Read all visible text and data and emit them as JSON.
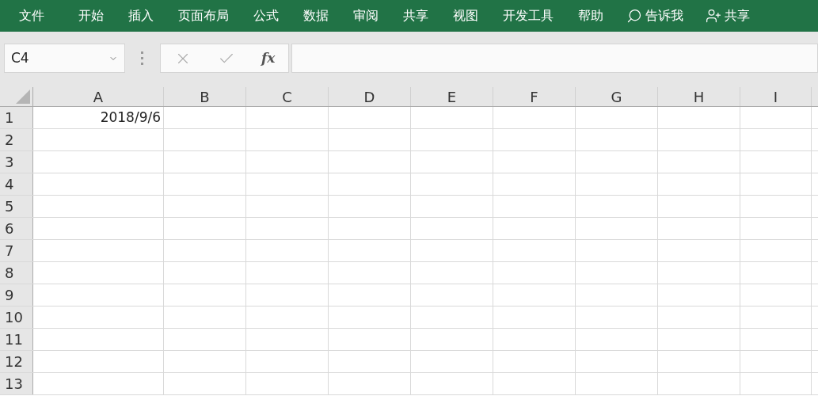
{
  "ribbon": {
    "tabs": [
      {
        "label": "文件"
      },
      {
        "label": "开始"
      },
      {
        "label": "插入"
      },
      {
        "label": "页面布局"
      },
      {
        "label": "公式"
      },
      {
        "label": "数据"
      },
      {
        "label": "审阅"
      },
      {
        "label": "共享"
      },
      {
        "label": "视图"
      },
      {
        "label": "开发工具"
      },
      {
        "label": "帮助"
      }
    ],
    "tell_me": "告诉我",
    "share": "共享"
  },
  "formula_bar": {
    "name_box": "C4",
    "function_button": "fx"
  },
  "sheet": {
    "columns": [
      "A",
      "B",
      "C",
      "D",
      "E",
      "F",
      "G",
      "H",
      "I"
    ],
    "rows": [
      {
        "header": "1",
        "cells": [
          "2018/9/6"
        ]
      },
      {
        "header": "2"
      },
      {
        "header": "3"
      },
      {
        "header": "4"
      },
      {
        "header": "5"
      },
      {
        "header": "6"
      },
      {
        "header": "7"
      },
      {
        "header": "8"
      },
      {
        "header": "9"
      },
      {
        "header": "10"
      },
      {
        "header": "11"
      },
      {
        "header": "12"
      },
      {
        "header": "13"
      }
    ]
  }
}
